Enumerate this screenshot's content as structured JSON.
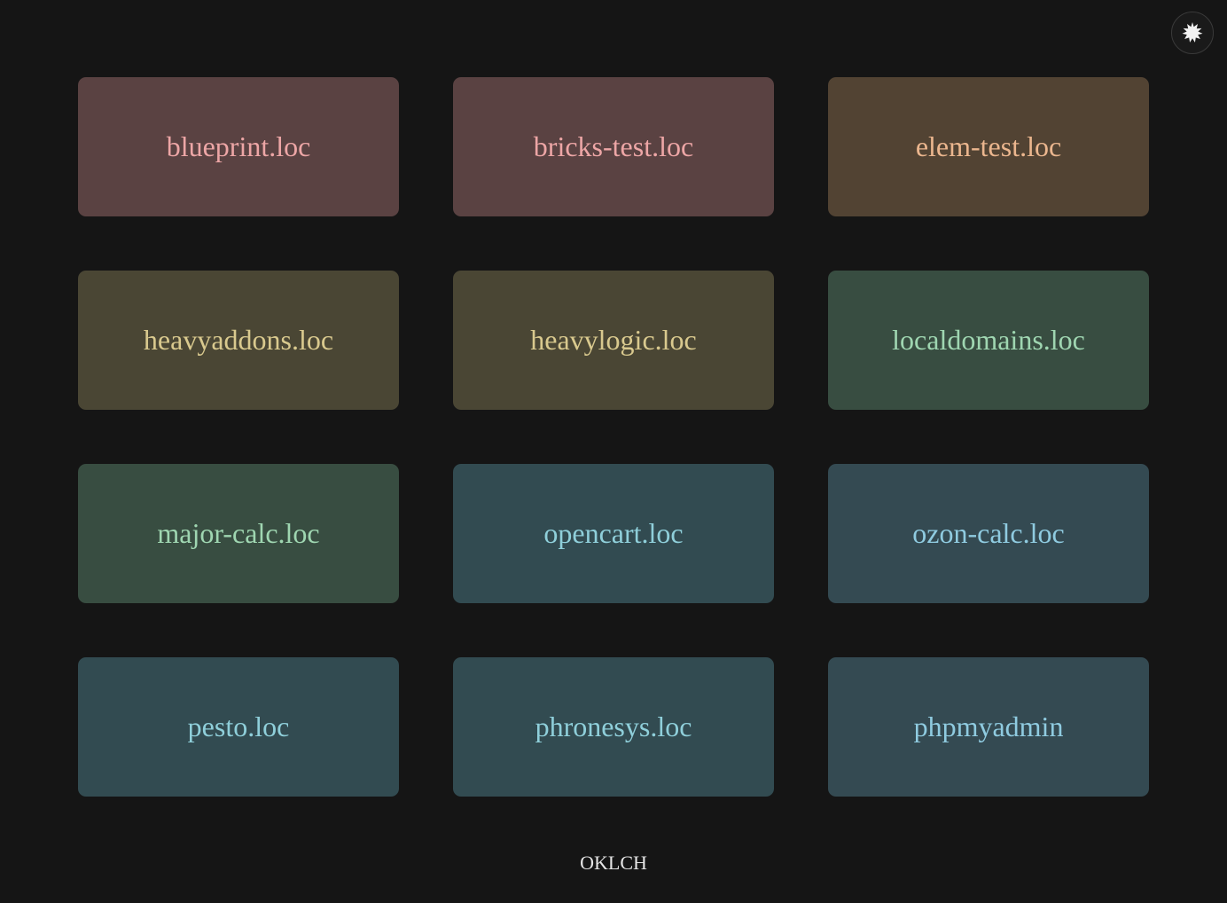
{
  "theme_toggle": {
    "icon": "sun-icon"
  },
  "tiles": [
    {
      "label": "blueprint.loc",
      "bg": "#5a4242",
      "fg": "#eda6a6"
    },
    {
      "label": "bricks-test.loc",
      "bg": "#5a4242",
      "fg": "#eda6a6"
    },
    {
      "label": "elem-test.loc",
      "bg": "#524333",
      "fg": "#ebb68e"
    },
    {
      "label": "heavyaddons.loc",
      "bg": "#4a4634",
      "fg": "#d9c98e"
    },
    {
      "label": "heavylogic.loc",
      "bg": "#4a4634",
      "fg": "#d9c98e"
    },
    {
      "label": "localdomains.loc",
      "bg": "#384d41",
      "fg": "#9fd6b1"
    },
    {
      "label": "major-calc.loc",
      "bg": "#384d41",
      "fg": "#9fd6b1"
    },
    {
      "label": "opencart.loc",
      "bg": "#324b51",
      "fg": "#8fcfda"
    },
    {
      "label": "ozon-calc.loc",
      "bg": "#344a52",
      "fg": "#8fcbe0"
    },
    {
      "label": "pesto.loc",
      "bg": "#324b51",
      "fg": "#8fcfda"
    },
    {
      "label": "phronesys.loc",
      "bg": "#324b51",
      "fg": "#8fcfda"
    },
    {
      "label": "phpmyadmin",
      "bg": "#344a52",
      "fg": "#8fcbe0"
    }
  ],
  "footer": {
    "label": "OKLCH"
  }
}
